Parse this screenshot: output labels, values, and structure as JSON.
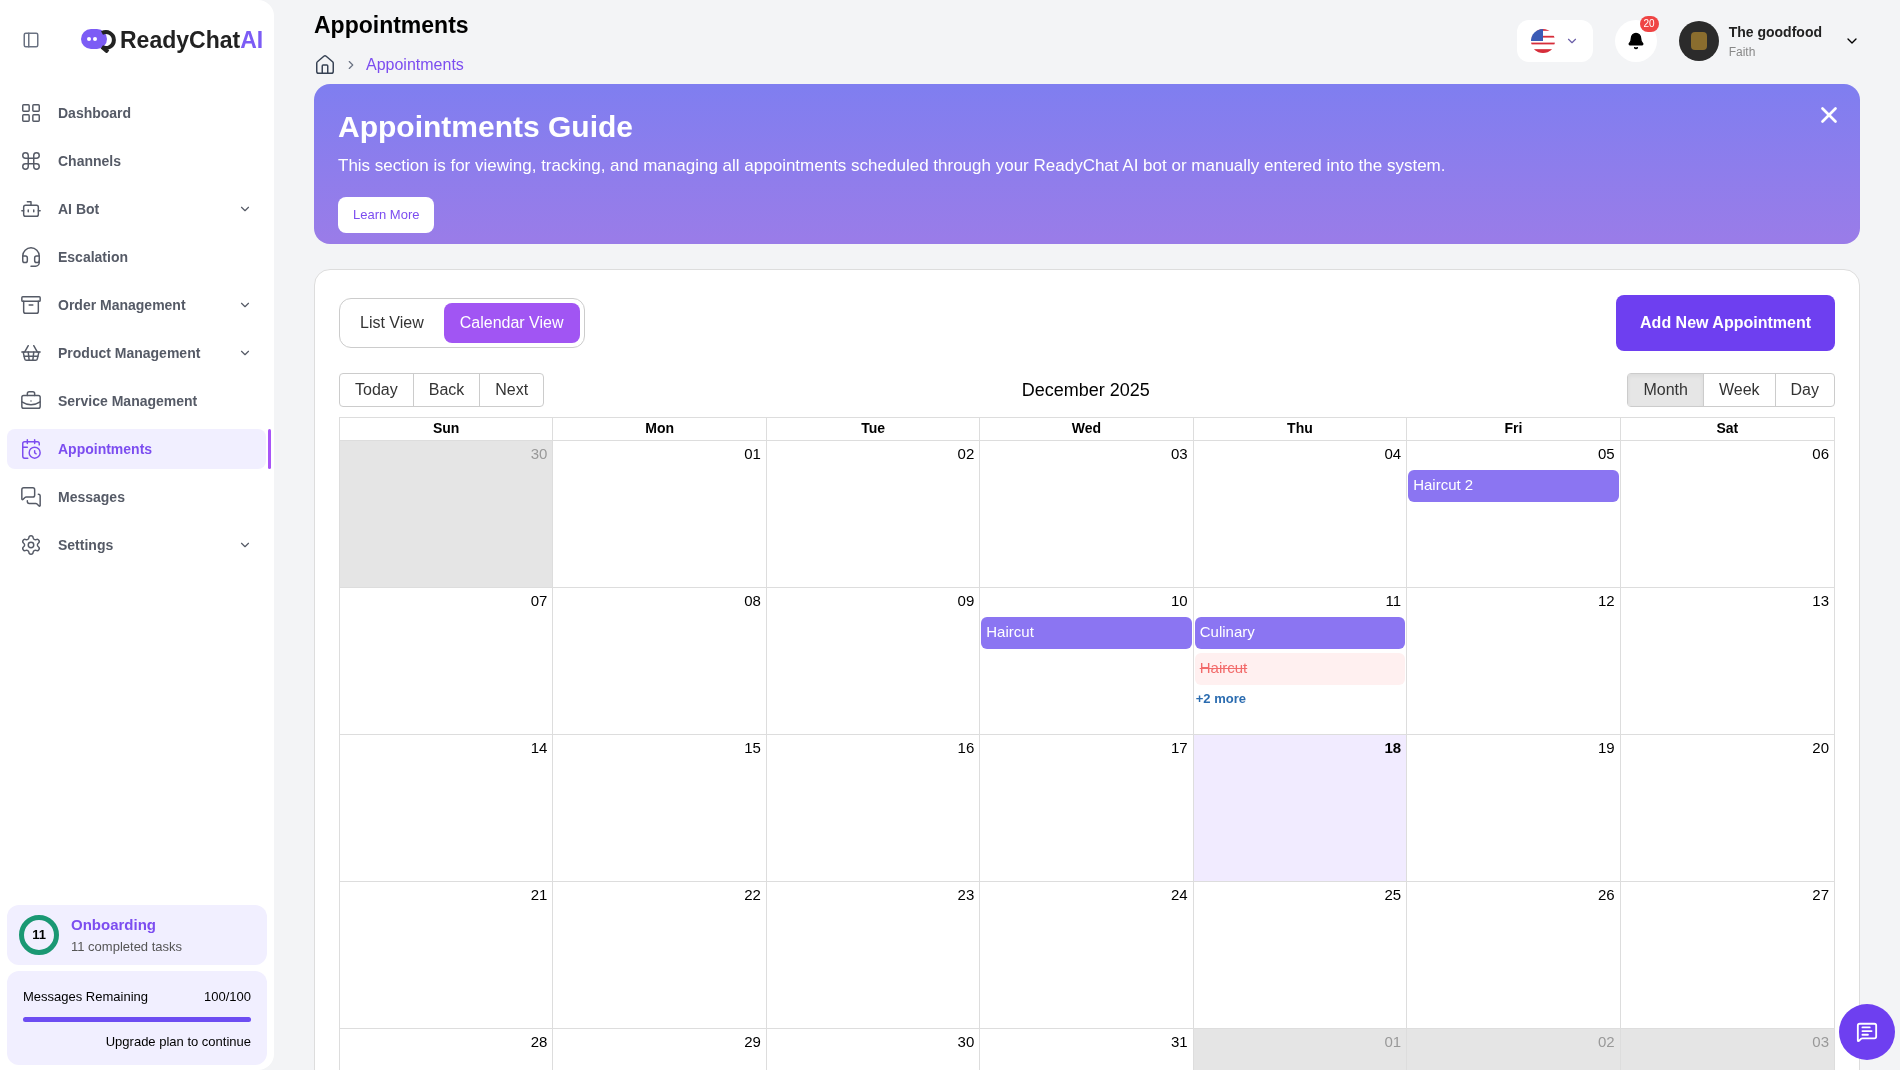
{
  "brand": {
    "name": "ReadyChat",
    "suffix": "AI"
  },
  "sidebar": {
    "items": [
      {
        "label": "Dashboard",
        "selected": false,
        "expandable": false
      },
      {
        "label": "Channels",
        "selected": false,
        "expandable": false
      },
      {
        "label": "AI Bot",
        "selected": false,
        "expandable": true
      },
      {
        "label": "Escalation",
        "selected": false,
        "expandable": false
      },
      {
        "label": "Order Management",
        "selected": false,
        "expandable": true
      },
      {
        "label": "Product Management",
        "selected": false,
        "expandable": true
      },
      {
        "label": "Service Management",
        "selected": false,
        "expandable": false
      },
      {
        "label": "Appointments",
        "selected": true,
        "expandable": false
      },
      {
        "label": "Messages",
        "selected": false,
        "expandable": false
      },
      {
        "label": "Settings",
        "selected": false,
        "expandable": true
      }
    ],
    "onboarding": {
      "count": "11",
      "title": "Onboarding",
      "subtitle": "11 completed tasks"
    },
    "messages_remaining": {
      "label": "Messages Remaining",
      "value": "100/100",
      "level": 1,
      "note": "Upgrade plan to continue"
    }
  },
  "header": {
    "title": "Appointments",
    "breadcrumb": "Appointments",
    "notifications": "20",
    "user": {
      "name": "The goodfood",
      "role": "Faith"
    }
  },
  "guide": {
    "title": "Appointments Guide",
    "text": "This section is for viewing, tracking, and managing all appointments scheduled through your ReadyChat AI bot or manually entered into the system.",
    "button": "Learn More"
  },
  "view_toggle": [
    {
      "label": "List View",
      "selected": false
    },
    {
      "label": "Calendar View",
      "selected": true
    }
  ],
  "add_button": "Add New Appointment",
  "nav_buttons": [
    "Today",
    "Back",
    "Next"
  ],
  "month_label": "December 2025",
  "range_buttons": [
    {
      "label": "Month",
      "selected": true
    },
    {
      "label": "Week",
      "selected": false
    },
    {
      "label": "Day",
      "selected": false
    }
  ],
  "weekdays": [
    "Sun",
    "Mon",
    "Tue",
    "Wed",
    "Thu",
    "Fri",
    "Sat"
  ],
  "weeks": [
    {
      "days": [
        {
          "label": "30",
          "outside": true,
          "today": false
        },
        {
          "label": "01",
          "outside": false,
          "today": false
        },
        {
          "label": "02",
          "outside": false,
          "today": false
        },
        {
          "label": "03",
          "outside": false,
          "today": false
        },
        {
          "label": "04",
          "outside": false,
          "today": false
        },
        {
          "label": "05",
          "outside": false,
          "today": false,
          "events": [
            {
              "title": "Haircut 2",
              "cancelled": false
            }
          ]
        },
        {
          "label": "06",
          "outside": false,
          "today": false
        }
      ]
    },
    {
      "days": [
        {
          "label": "07",
          "outside": false,
          "today": false
        },
        {
          "label": "08",
          "outside": false,
          "today": false
        },
        {
          "label": "09",
          "outside": false,
          "today": false
        },
        {
          "label": "10",
          "outside": false,
          "today": false,
          "events": [
            {
              "title": "Haircut",
              "cancelled": false
            }
          ]
        },
        {
          "label": "11",
          "outside": false,
          "today": false,
          "events": [
            {
              "title": "Culinary",
              "cancelled": false
            },
            {
              "title": "Haircut",
              "cancelled": true
            }
          ],
          "more": "+2 more"
        },
        {
          "label": "12",
          "outside": false,
          "today": false
        },
        {
          "label": "13",
          "outside": false,
          "today": false
        }
      ]
    },
    {
      "days": [
        {
          "label": "14",
          "outside": false,
          "today": false
        },
        {
          "label": "15",
          "outside": false,
          "today": false
        },
        {
          "label": "16",
          "outside": false,
          "today": false
        },
        {
          "label": "17",
          "outside": false,
          "today": false
        },
        {
          "label": "18",
          "outside": false,
          "today": true
        },
        {
          "label": "19",
          "outside": false,
          "today": false
        },
        {
          "label": "20",
          "outside": false,
          "today": false
        }
      ]
    },
    {
      "days": [
        {
          "label": "21",
          "outside": false,
          "today": false
        },
        {
          "label": "22",
          "outside": false,
          "today": false
        },
        {
          "label": "23",
          "outside": false,
          "today": false
        },
        {
          "label": "24",
          "outside": false,
          "today": false
        },
        {
          "label": "25",
          "outside": false,
          "today": false
        },
        {
          "label": "26",
          "outside": false,
          "today": false
        },
        {
          "label": "27",
          "outside": false,
          "today": false
        }
      ]
    },
    {
      "days": [
        {
          "label": "28",
          "outside": false,
          "today": false
        },
        {
          "label": "29",
          "outside": false,
          "today": false
        },
        {
          "label": "30",
          "outside": false,
          "today": false
        },
        {
          "label": "31",
          "outside": false,
          "today": false
        },
        {
          "label": "01",
          "outside": true,
          "today": false
        },
        {
          "label": "02",
          "outside": true,
          "today": false
        },
        {
          "label": "03",
          "outside": true,
          "today": false
        }
      ]
    }
  ]
}
